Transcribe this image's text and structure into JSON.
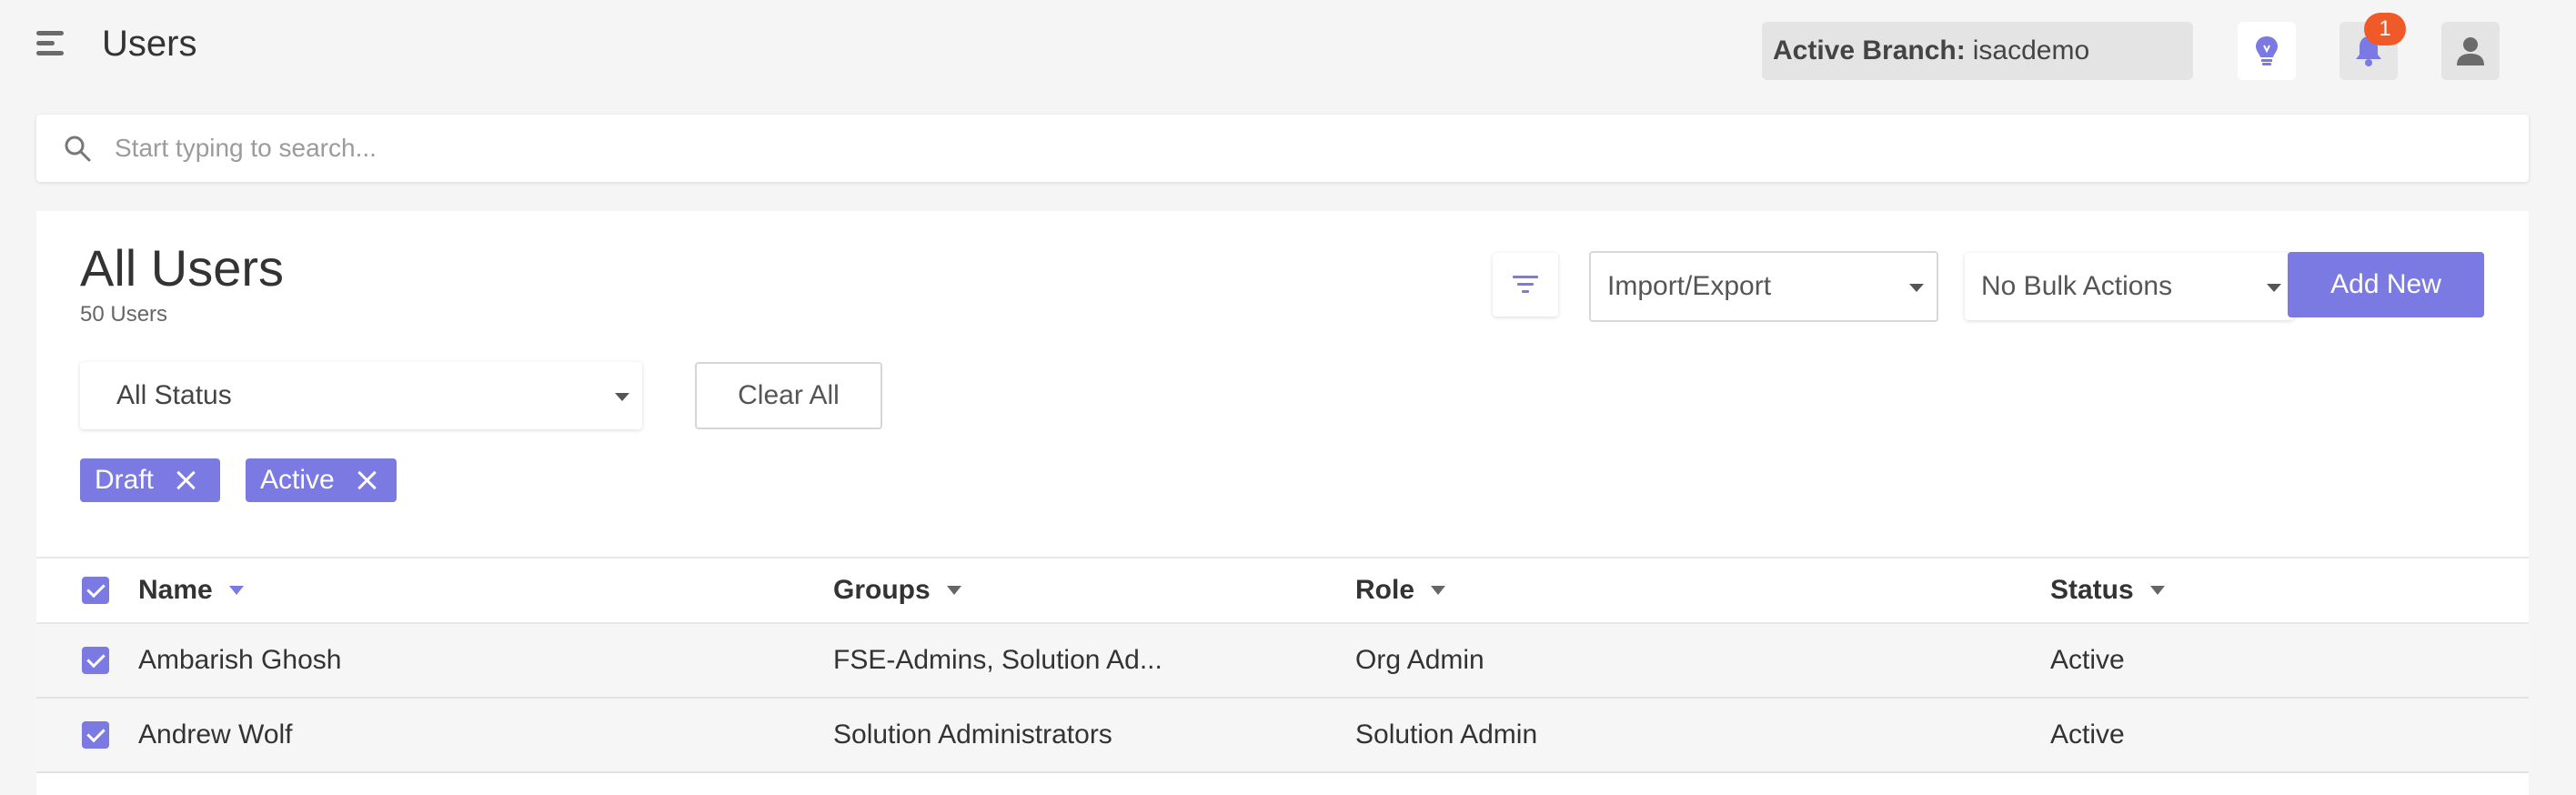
{
  "header": {
    "title": "Users",
    "branch_label": "Active Branch:",
    "branch_value": "isacdemo",
    "notification_count": "1"
  },
  "search": {
    "placeholder": "Start typing to search..."
  },
  "card": {
    "title": "All Users",
    "count": "50 Users",
    "import_export_label": "Import/Export",
    "bulk_actions_label": "No Bulk Actions",
    "add_new_label": "Add New",
    "status_filter_label": "All Status",
    "clear_all_label": "Clear All",
    "chips": [
      "Draft",
      "Active"
    ]
  },
  "table": {
    "columns": [
      "Name",
      "Groups",
      "Role",
      "Status"
    ],
    "rows": [
      {
        "name": "Ambarish Ghosh",
        "groups": "FSE-Admins, Solution Ad...",
        "role": "Org Admin",
        "status": "Active",
        "checked": true
      },
      {
        "name": "Andrew Wolf",
        "groups": "Solution Administrators",
        "role": "Solution Admin",
        "status": "Active",
        "checked": true
      }
    ]
  },
  "colors": {
    "accent": "#7b79e2",
    "badge": "#f05a28",
    "background": "#f5f5f5"
  },
  "icons": [
    "menu-icon",
    "lightbulb-icon",
    "bell-icon",
    "user-icon",
    "search-icon",
    "filter-icon",
    "close-icon",
    "sort-down-icon",
    "check-icon"
  ]
}
